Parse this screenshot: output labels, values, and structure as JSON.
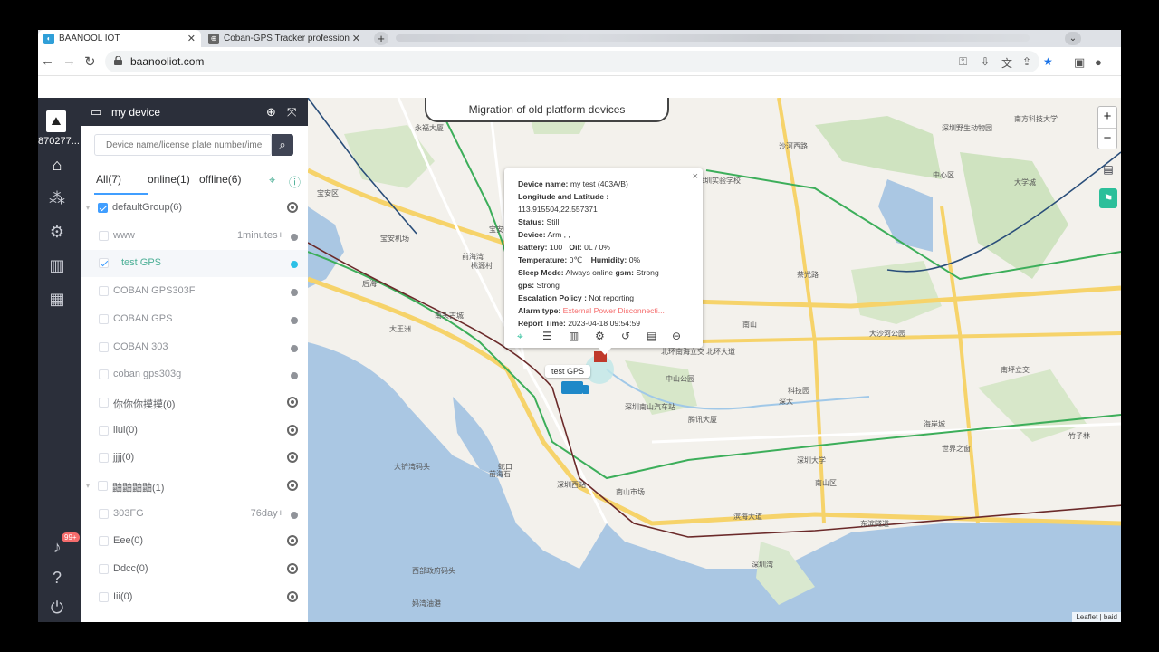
{
  "browser": {
    "tabs": [
      {
        "title": "BAANOOL IOT",
        "active": true
      },
      {
        "title": "Coban-GPS Tracker profession",
        "active": false
      }
    ],
    "url": "baanooliot.com"
  },
  "rail": {
    "account": "870277...",
    "notification_badge": "99+"
  },
  "panel": {
    "title": "my device",
    "search_placeholder": "Device name/license plate number/ime",
    "filters": {
      "all": "All(7)",
      "online": "online(1)",
      "offline": "offline(6)"
    },
    "tree": [
      {
        "label": "defaultGroup(6)",
        "type": "group",
        "checked": true
      },
      {
        "label": "www",
        "type": "device",
        "time": "1minutes+",
        "status": "offline"
      },
      {
        "label": "test GPS",
        "type": "device",
        "time": "",
        "status": "online",
        "selected": true
      },
      {
        "label": "COBAN GPS303F",
        "type": "device",
        "time": "",
        "status": "offline"
      },
      {
        "label": "COBAN GPS",
        "type": "device",
        "time": "",
        "status": "offline"
      },
      {
        "label": "COBAN 303",
        "type": "device",
        "time": "",
        "status": "offline"
      },
      {
        "label": "coban gps303g",
        "type": "device",
        "time": "",
        "status": "offline"
      },
      {
        "label": "你你你摸摸(0)",
        "type": "group"
      },
      {
        "label": "iiui(0)",
        "type": "group"
      },
      {
        "label": "jjjj(0)",
        "type": "group"
      },
      {
        "label": "鼬鼬鼬鼬(1)",
        "type": "group"
      },
      {
        "label": "303FG",
        "type": "device",
        "time": "76day+",
        "status": "offline"
      },
      {
        "label": "Eee(0)",
        "type": "group"
      },
      {
        "label": "Ddcc(0)",
        "type": "group"
      },
      {
        "label": "Iii(0)",
        "type": "group"
      }
    ]
  },
  "map": {
    "banner": "Migration of old platform devices",
    "device_label": "test GPS",
    "attribution": "Leaflet | baid",
    "popup": {
      "device_name_label": "Device name:",
      "device_name": "my test (403A/B)",
      "lonlat_label": "Longitude and Latitude :",
      "lonlat": "113.915504,22.557371",
      "status_label": "Status:",
      "status": "Still",
      "device_label": "Device:",
      "device": "Arm  ,   ,",
      "battery_label": "Battery:",
      "battery": "100",
      "oil_label": "Oil:",
      "oil": "0L / 0%",
      "temp_label": "Temperature:",
      "temp": "0℃",
      "humidity_label": "Humidity:",
      "humidity": "0%",
      "sleep_label": "Sleep Mode:",
      "sleep": "Always online",
      "gsm_label": "gsm:",
      "gsm": "Strong",
      "gps_label": "gps:",
      "gps": "Strong",
      "escalation_label": "Escalation Policy :",
      "escalation": "Not reporting",
      "alarm_label": "Alarm type:",
      "alarm": "External Power Disconnecti...",
      "report_label": "Report Time:",
      "report": "2023-04-18 09:54:59"
    },
    "place_labels": [
      "宝安区",
      "永福大厦",
      "深圳野生动物园",
      "南方科技大学",
      "沙河西路",
      "深圳实验学校",
      "大学城",
      "中心区",
      "宝安机场",
      "宝安中心",
      "前海湾",
      "后海",
      "南头古城",
      "南山",
      "科技园",
      "深大",
      "大王洲",
      "桃源村",
      "茶光路",
      "北环大道",
      "南坪立交",
      "大沙河公园",
      "深圳湾",
      "滨海大道",
      "东滨隧道",
      "深圳大学",
      "南山市场",
      "南山区",
      "大铲湾码头",
      "蛇口",
      "前海石",
      "深圳西站",
      "西部政府码头",
      "妈湾油港",
      "深圳南山汽车站",
      "竹子林",
      "世界之窗",
      "北环南海立交",
      "中山公园",
      "腾讯大厦",
      "海岸城"
    ]
  }
}
